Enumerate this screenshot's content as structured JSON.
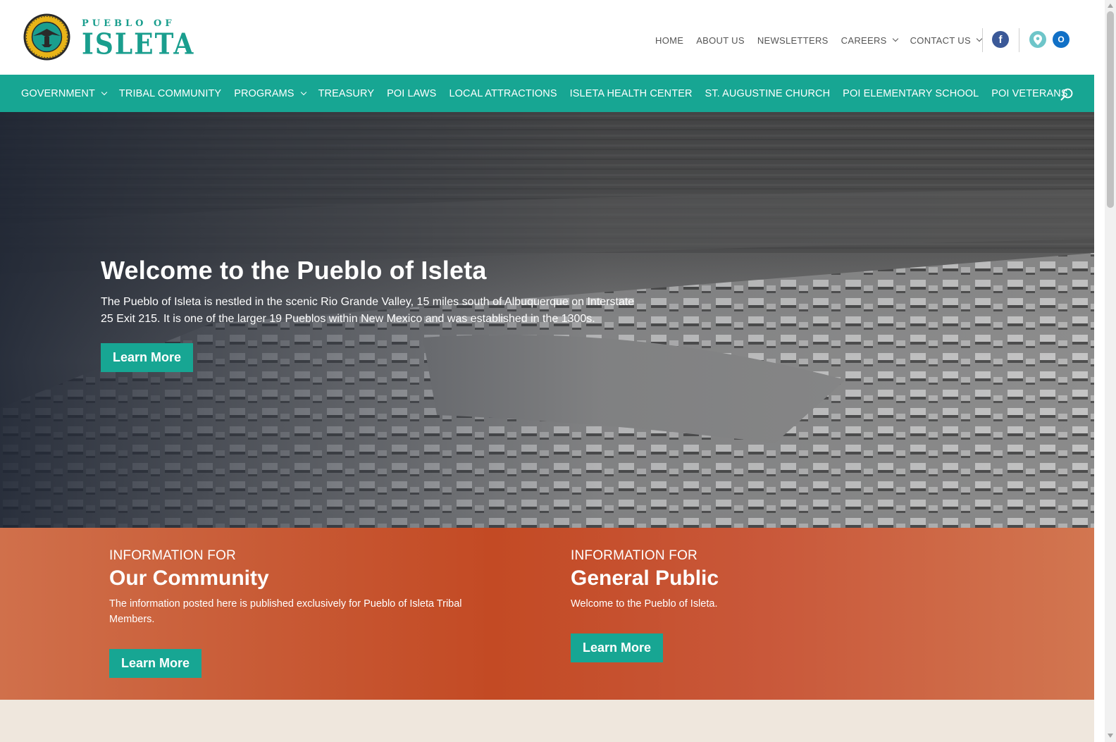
{
  "brand": {
    "line1": "PUEBLO OF",
    "line2": "ISLETA",
    "teal": "#17a693",
    "accent_orange": "#c34a24"
  },
  "top_nav": [
    {
      "label": "HOME",
      "has_dropdown": false
    },
    {
      "label": "ABOUT US",
      "has_dropdown": false
    },
    {
      "label": "NEWSLETTERS",
      "has_dropdown": false
    },
    {
      "label": "CAREERS",
      "has_dropdown": true
    },
    {
      "label": "CONTACT US",
      "has_dropdown": true
    }
  ],
  "social": {
    "facebook_glyph": "f",
    "outlook_glyph": "O",
    "icons": [
      "facebook-icon",
      "map-pin-icon",
      "outlook-mail-icon"
    ]
  },
  "main_nav": [
    {
      "label": "GOVERNMENT",
      "has_dropdown": true
    },
    {
      "label": "TRIBAL COMMUNITY",
      "has_dropdown": false
    },
    {
      "label": "PROGRAMS",
      "has_dropdown": true
    },
    {
      "label": "TREASURY",
      "has_dropdown": false
    },
    {
      "label": "POI LAWS",
      "has_dropdown": false
    },
    {
      "label": "LOCAL ATTRACTIONS",
      "has_dropdown": false
    },
    {
      "label": "ISLETA HEALTH CENTER",
      "has_dropdown": false
    },
    {
      "label": "ST. AUGUSTINE CHURCH",
      "has_dropdown": false
    },
    {
      "label": "POI ELEMENTARY SCHOOL",
      "has_dropdown": false
    },
    {
      "label": "POI VETERANS",
      "has_dropdown": false
    }
  ],
  "hero": {
    "title": "Welcome to the Pueblo of Isleta",
    "text": "The Pueblo of Isleta is nestled in the scenic Rio Grande Valley, 15 miles south of Albuquerque on Interstate 25 Exit 215.  It is one of the larger 19 Pueblos within New Mexico and was established in the 1300s.",
    "button": "Learn More"
  },
  "info": {
    "community": {
      "label": "INFORMATION FOR",
      "title": "Our Community",
      "text": "The information posted here is published exclusively for Pueblo of Isleta Tribal Members.",
      "button": "Learn More"
    },
    "public": {
      "label": "INFORMATION FOR",
      "title": "General Public",
      "text": "Welcome to the Pueblo of Isleta.",
      "button": "Learn More"
    }
  }
}
